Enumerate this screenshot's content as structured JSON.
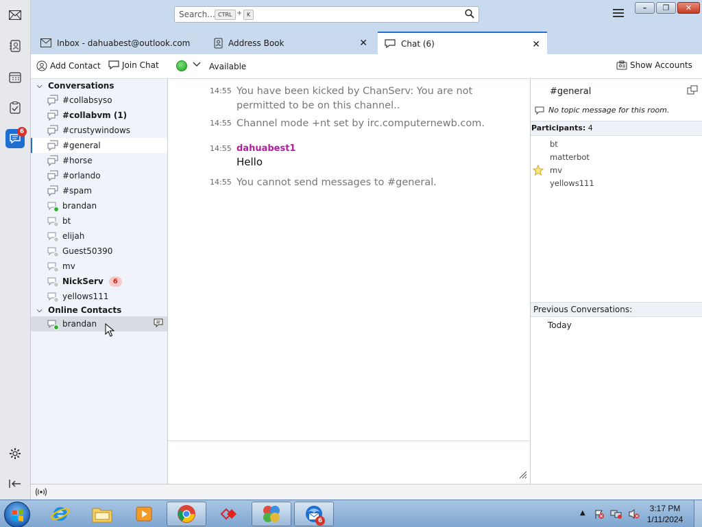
{
  "search": {
    "placeholder": "Search...",
    "key1": "CTRL",
    "plus": "+",
    "key2": "K"
  },
  "tabs": [
    {
      "label": "Inbox - dahuabest@outlook.com"
    },
    {
      "label": "Address Book"
    },
    {
      "label": "Chat (6)"
    }
  ],
  "spaces": {
    "chat_badge": "6"
  },
  "toolbar": {
    "add_contact": "Add Contact",
    "join_chat": "Join Chat",
    "status": "Available",
    "show_accounts": "Show Accounts"
  },
  "sidebar": {
    "conversations_header": "Conversations",
    "online_header": "Online Contacts",
    "conversations": [
      {
        "name": "#collabsyso"
      },
      {
        "name": "#collabvm (1)"
      },
      {
        "name": "#crustywindows"
      },
      {
        "name": "#general"
      },
      {
        "name": "#horse"
      },
      {
        "name": "#orlando"
      },
      {
        "name": "#spam"
      },
      {
        "name": "brandan"
      },
      {
        "name": "bt"
      },
      {
        "name": "elijah"
      },
      {
        "name": "Guest50390"
      },
      {
        "name": "mv"
      },
      {
        "name": "NickServ",
        "badge": "6"
      },
      {
        "name": "yellows111"
      }
    ],
    "online": [
      {
        "name": "brandan"
      }
    ]
  },
  "messages": [
    {
      "time": "14:55",
      "text": "You have been kicked by ChanServ: You are not permitted to be on this channel.."
    },
    {
      "time": "14:55",
      "text": "Channel mode +nt set by irc.computernewb.com."
    },
    {
      "time": "14:55",
      "sender": "dahuabest1",
      "text": "Hello"
    },
    {
      "time": "14:55",
      "text": "You cannot send messages to #general."
    }
  ],
  "room": {
    "name": "#general",
    "topic": "No topic message for this room.",
    "participants_label": "Participants:",
    "participants_count": "4",
    "participants": [
      "bt",
      "matterbot",
      "mv",
      "yellows111"
    ],
    "previous_label": "Previous Conversations:",
    "previous_today": "Today"
  },
  "taskbar": {
    "time": "3:17 PM",
    "date": "1/11/2024",
    "thunderbird_badge": "6"
  },
  "colors": {
    "accent": "#1f6fd0",
    "sender": "#b01fa0",
    "online": "#2ab52a",
    "badge": "#d6332a"
  }
}
